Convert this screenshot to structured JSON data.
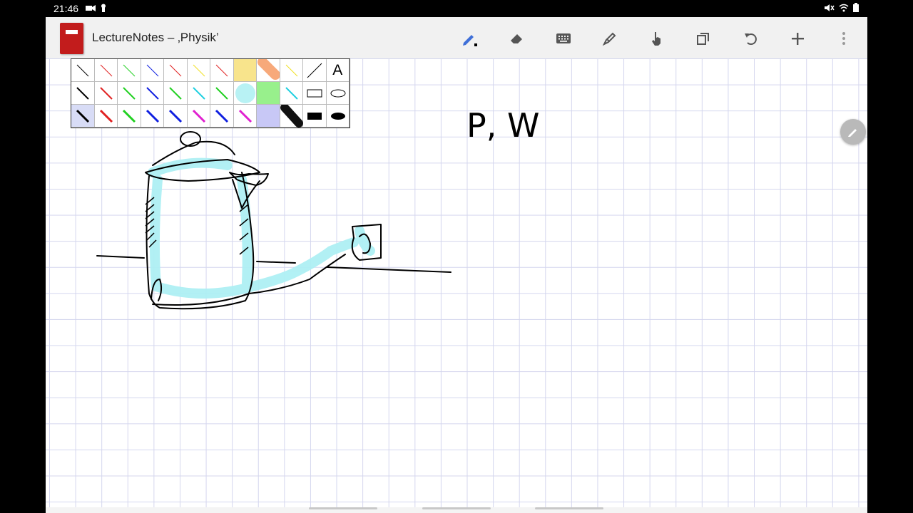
{
  "status_bar": {
    "time": "21:46",
    "left_icons": [
      "camera-icon",
      "keyhole-icon"
    ],
    "right_icons": [
      "mute-icon",
      "wifi-icon",
      "battery-icon"
    ]
  },
  "app": {
    "title": "LectureNotes – ‚Physik’",
    "toolbar_icons": [
      "pen-icon",
      "eraser-icon",
      "keyboard-icon",
      "highlighter-icon",
      "hand-icon",
      "copy-icon",
      "undo-icon",
      "add-icon",
      "more-vert-icon"
    ]
  },
  "palette": {
    "text_tool_label": "A",
    "colors": {
      "black": "#000000",
      "red": "#e02020",
      "green": "#20d020",
      "blue": "#1020e0",
      "yellow": "#f0e020",
      "cyan": "#20d0e0",
      "magenta": "#e020d0",
      "highlight_yellow": "#f8e48c",
      "highlight_orange": "#f7a97a",
      "highlight_cyan": "#b8f2f4",
      "highlight_green": "#98f08c",
      "highlight_lavender": "#c8c8f6"
    }
  },
  "canvas": {
    "handwriting": "P, W",
    "grid_color": "#d4d6ee",
    "sketch_fill_color": "#aef0f4"
  }
}
